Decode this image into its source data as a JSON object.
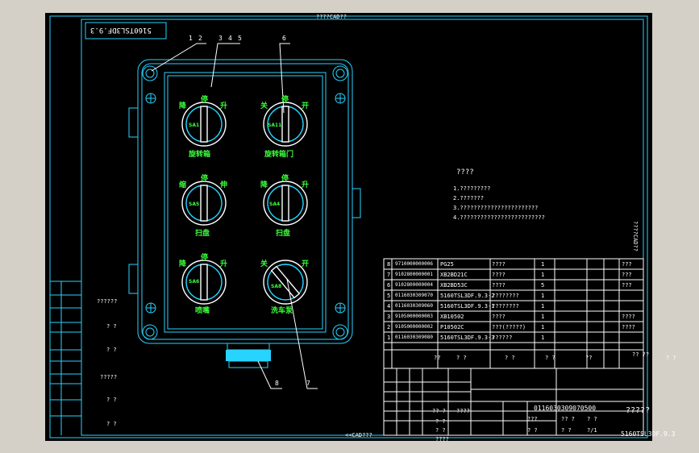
{
  "frame": {
    "top_tag": "????CAD??",
    "bottom_tag": "<<CAD???",
    "right_tag": "????CAD??",
    "mirror_code": "5160TSL3DF.9.3"
  },
  "callouts": [
    "1",
    "2",
    "3",
    "4",
    "5",
    "6",
    "7",
    "8"
  ],
  "switches": [
    {
      "left": "降",
      "mid": "停",
      "right": "升",
      "code": "SA1",
      "caption": "旋转箱"
    },
    {
      "left": "关",
      "mid": "停",
      "right": "开",
      "code": "SA11",
      "caption": "旋转箱门"
    },
    {
      "left": "缩",
      "mid": "停",
      "right": "伸",
      "code": "SA5",
      "caption": "扫盘"
    },
    {
      "left": "降",
      "mid": "停",
      "right": "升",
      "code": "SA4",
      "caption": "扫盘"
    },
    {
      "left": "降",
      "mid": "停",
      "right": "升",
      "code": "SA6",
      "caption": "喷嘴"
    },
    {
      "left": "关",
      "mid": "",
      "right": "开",
      "code": "SA8",
      "caption": "洗车泵"
    }
  ],
  "notes": {
    "title": "????",
    "lines": [
      "1.?????????",
      "2.???????",
      "3.???????????????????????",
      "4.?????????????????????????"
    ]
  },
  "bom": {
    "rows": [
      {
        "no": "8",
        "code": "9710000000006",
        "name": "PG25",
        "desc": "????",
        "qty": "1",
        "note": "???"
      },
      {
        "no": "7",
        "code": "9102800000001",
        "name": "XB2BD21C",
        "desc": "????",
        "qty": "1",
        "note": "???"
      },
      {
        "no": "6",
        "code": "9102800000004",
        "name": "XB2BD53C",
        "desc": "????",
        "qty": "5",
        "note": "???"
      },
      {
        "no": "5",
        "code": "0116030309070",
        "name": "5160TSL3DF.9.3-2",
        "desc": "????????",
        "qty": "1",
        "note": ""
      },
      {
        "no": "4",
        "code": "0116030309060",
        "name": "5160TSL3DF.9.3-1",
        "desc": "????????",
        "qty": "1",
        "note": ""
      },
      {
        "no": "3",
        "code": "9105000000003",
        "name": "XB10502",
        "desc": "????",
        "qty": "1",
        "note": "????"
      },
      {
        "no": "2",
        "code": "9105000000002",
        "name": "P10502C",
        "desc": "???(?????)",
        "qty": "1",
        "note": "????"
      },
      {
        "no": "1",
        "code": "0116030309080",
        "name": "5160TSL3DF.9.3-3",
        "desc": "??????",
        "qty": "1",
        "note": ""
      }
    ],
    "header": [
      "??",
      "? ?",
      "? ?",
      "? ?",
      "??",
      "?? ??",
      "? ?"
    ]
  },
  "title_block": {
    "drawing_no": "0116030309070500",
    "name": "?????",
    "code": "5160TSL3DF.9.3",
    "r1": [
      "???",
      "?? ?",
      "? ?"
    ],
    "r2": [
      "? ?",
      "? ?",
      "?/1"
    ],
    "left": [
      "?? ?",
      "????",
      "? ?",
      "? ?",
      "????"
    ]
  },
  "side_panel": [
    "??????",
    "? ?",
    "? ?",
    "?????",
    "? ?",
    "? ?"
  ]
}
